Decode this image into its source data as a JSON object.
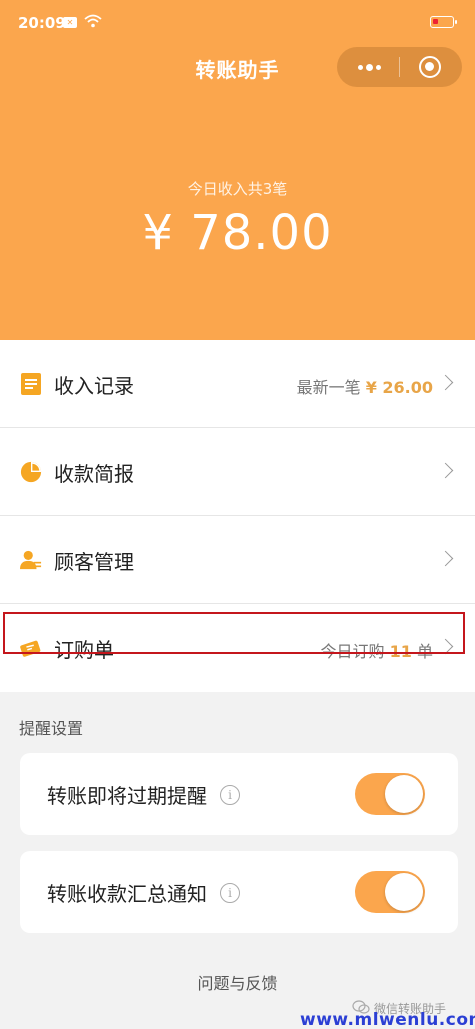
{
  "status_bar": {
    "time": "20:09",
    "notification_badge": "✕"
  },
  "header": {
    "title": "转账助手",
    "income_caption": "今日收入共3笔",
    "income_amount": "¥ 78.00",
    "accent_color": "#fba64d"
  },
  "menu": {
    "items": [
      {
        "label": "收入记录",
        "right_prefix": "最新一笔",
        "right_value": "¥ 26.00",
        "right_suffix": "",
        "icon": "document-icon"
      },
      {
        "label": "收款简报",
        "right_prefix": "",
        "right_value": "",
        "right_suffix": "",
        "icon": "pie-chart-icon"
      },
      {
        "label": "顾客管理",
        "right_prefix": "",
        "right_value": "",
        "right_suffix": "",
        "icon": "customer-icon"
      },
      {
        "label": "订购单",
        "right_prefix": "今日订购",
        "right_value": "11",
        "right_suffix": "单",
        "icon": "ticket-icon"
      }
    ]
  },
  "reminder_settings": {
    "title": "提醒设置",
    "items": [
      {
        "label": "转账即将过期提醒",
        "enabled": true
      },
      {
        "label": "转账收款汇总通知",
        "enabled": true
      }
    ]
  },
  "footer": {
    "feedback_link": "问题与反馈",
    "watermark_text": "微信转账助手",
    "watermark_url": "www.mlwenlu.com"
  }
}
